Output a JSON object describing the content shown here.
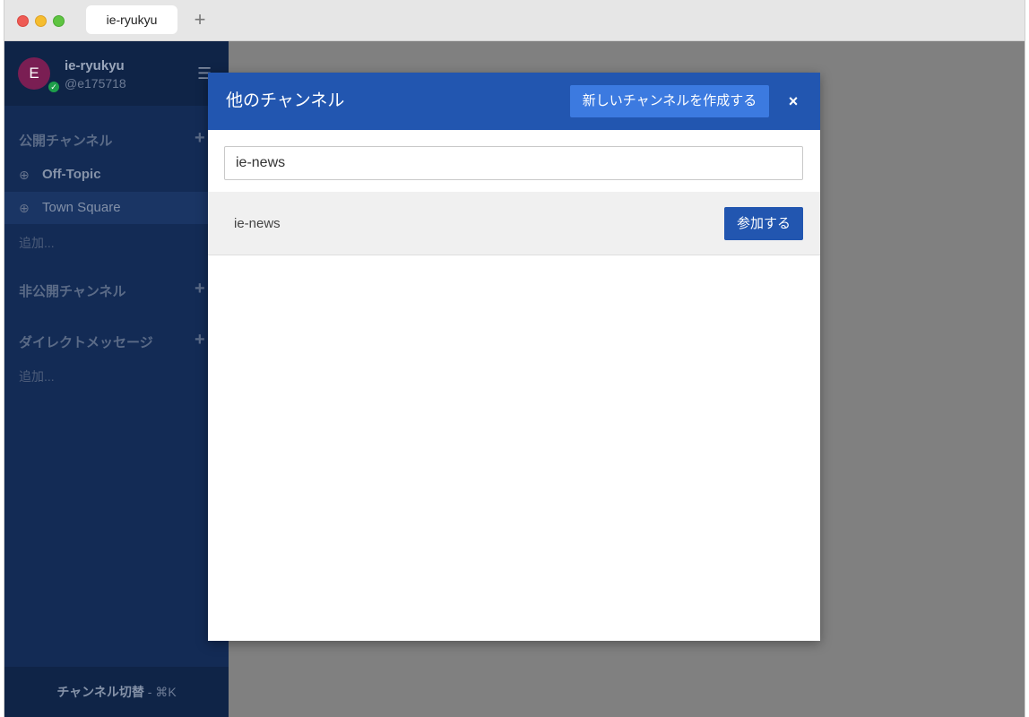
{
  "browser": {
    "tab_title": "ie-ryukyu",
    "new_tab_icon": "+"
  },
  "sidebar": {
    "avatar_initial": "E",
    "team_name": "ie-ryukyu",
    "username": "@e175718",
    "public_channels": {
      "title": "公開チャンネル",
      "add": "+",
      "items": [
        {
          "label": "Off-Topic",
          "bold": true,
          "active": false
        },
        {
          "label": "Town Square",
          "bold": false,
          "active": true
        }
      ],
      "more": "追加..."
    },
    "private_channels": {
      "title": "非公開チャンネル",
      "add": "+"
    },
    "direct_messages": {
      "title": "ダイレクトメッセージ",
      "add": "+",
      "more": "追加..."
    },
    "footer": {
      "label": "チャンネル切替",
      "shortcut": " - ⌘K"
    }
  },
  "modal": {
    "title": "他のチャンネル",
    "create_button": "新しいチャンネルを作成する",
    "close": "×",
    "search": {
      "value": "ie-news",
      "placeholder": ""
    },
    "results": [
      {
        "name": "ie-news",
        "join_label": "参加する"
      }
    ]
  },
  "colors": {
    "sidebar_bg": "#132b55",
    "modal_header": "#2256b0",
    "create_button": "#3c7ae0",
    "overlay": "#808080"
  }
}
